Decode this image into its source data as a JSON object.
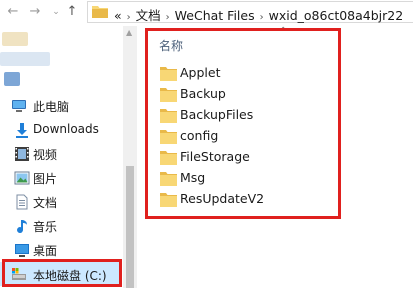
{
  "address_bar": {
    "overflow": "«",
    "path": [
      "文档",
      "WeChat Files",
      "wxid_o86ct08a4bjr22"
    ]
  },
  "sidebar": {
    "items": [
      {
        "label": "此电脑",
        "icon": "computer-icon"
      },
      {
        "label": "Downloads",
        "icon": "download-arrow-icon"
      },
      {
        "label": "视频",
        "icon": "film-icon"
      },
      {
        "label": "图片",
        "icon": "pictures-icon"
      },
      {
        "label": "文档",
        "icon": "document-icon"
      },
      {
        "label": "音乐",
        "icon": "music-note-icon"
      },
      {
        "label": "桌面",
        "icon": "desktop-icon"
      },
      {
        "label": "本地磁盘 (C:)",
        "icon": "drive-icon",
        "selected": true
      }
    ]
  },
  "file_list": {
    "column_header": "名称",
    "folders": [
      "Applet",
      "Backup",
      "BackupFiles",
      "config",
      "FileStorage",
      "Msg",
      "ResUpdateV2"
    ]
  },
  "colors": {
    "highlight": "#e0201e",
    "folder": "#f8d775",
    "selection": "#cce8ff"
  }
}
